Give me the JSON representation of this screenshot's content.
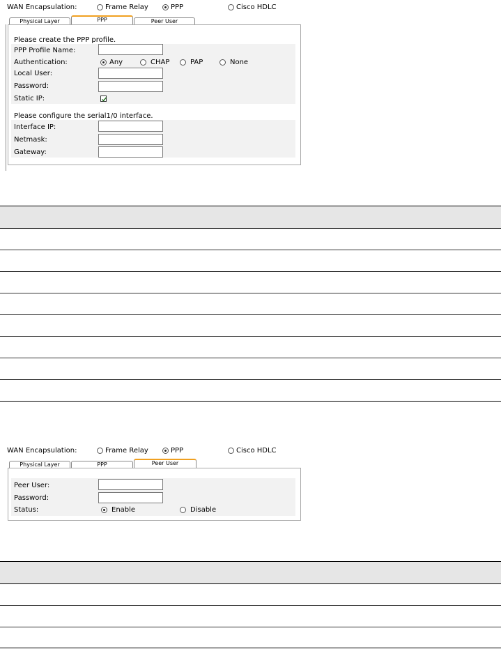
{
  "figure1": {
    "wan_label": "WAN Encapsulation:",
    "encap_options": [
      "Frame Relay",
      "PPP",
      "Cisco HDLC"
    ],
    "tabs": [
      "Physical Layer",
      "PPP",
      "Peer User"
    ],
    "active_tab": "PPP",
    "section1_title": "Please create the PPP profile.",
    "profile_name_label": "PPP Profile Name:",
    "auth_label": "Authentication:",
    "auth_options": [
      "Any",
      "CHAP",
      "PAP",
      "None"
    ],
    "auth_selected": "Any",
    "local_user_label": "Local User:",
    "password_label": "Password:",
    "static_ip_label": "Static IP:",
    "static_ip_checked": true,
    "section2_title": "Please configure the serial1/0 interface.",
    "interface_ip_label": "Interface IP:",
    "netmask_label": "Netmask:",
    "gateway_label": "Gateway:",
    "fields": {
      "profile_name": "",
      "local_user": "",
      "password": "",
      "interface_ip": "",
      "netmask": "",
      "gateway": ""
    }
  },
  "figure2": {
    "wan_label": "WAN Encapsulation:",
    "encap_options": [
      "Frame Relay",
      "PPP",
      "Cisco HDLC"
    ],
    "tabs": [
      "Physical Layer",
      "PPP",
      "Peer User"
    ],
    "active_tab": "Peer User",
    "peer_user_label": "Peer User:",
    "password_label": "Password:",
    "status_label": "Status:",
    "status_options": [
      "Enable",
      "Disable"
    ],
    "status_selected": "Enable",
    "fields": {
      "peer_user": "",
      "password": ""
    }
  },
  "colors": {
    "active_tab_accent": "#f0a020",
    "panel_border": "#a8a8a8",
    "shaded_row": "#f2f2f2",
    "table_header": "#e6e6e6"
  }
}
